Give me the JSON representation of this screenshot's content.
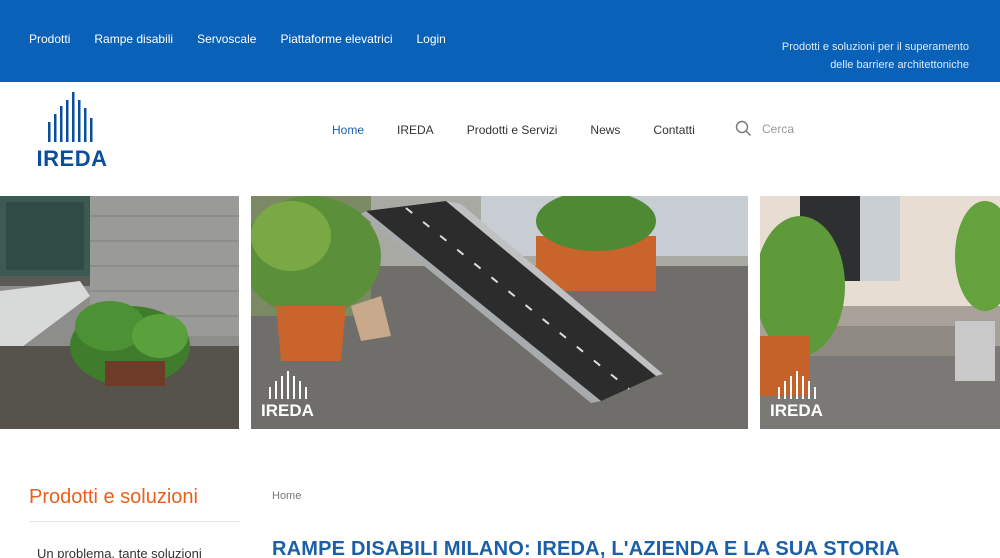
{
  "topbar": {
    "nav": [
      "Prodotti",
      "Rampe disabili",
      "Servoscale",
      "Piattaforme elevatrici",
      "Login"
    ],
    "tagline_line1": "Prodotti e soluzioni per il superamento",
    "tagline_line2": "delle barriere architettoniche"
  },
  "header": {
    "logo_text": "IREDA",
    "nav": [
      "Home",
      "IREDA",
      "Prodotti e Servizi",
      "News",
      "Contatti"
    ],
    "active_nav": "Home",
    "search_placeholder": "Cerca"
  },
  "slider": {
    "watermark_text": "IREDA"
  },
  "sidebar": {
    "title": "Prodotti e soluzioni",
    "first_item": "Un problema, tante soluzioni"
  },
  "main": {
    "breadcrumb": "Home",
    "heading": "RAMPE DISABILI MILANO: IREDA, L'AZIENDA E LA SUA STORIA"
  },
  "colors": {
    "topbar_bg": "#0a61b8",
    "brand_blue": "#0b4f9c",
    "accent_orange": "#e8611a"
  }
}
